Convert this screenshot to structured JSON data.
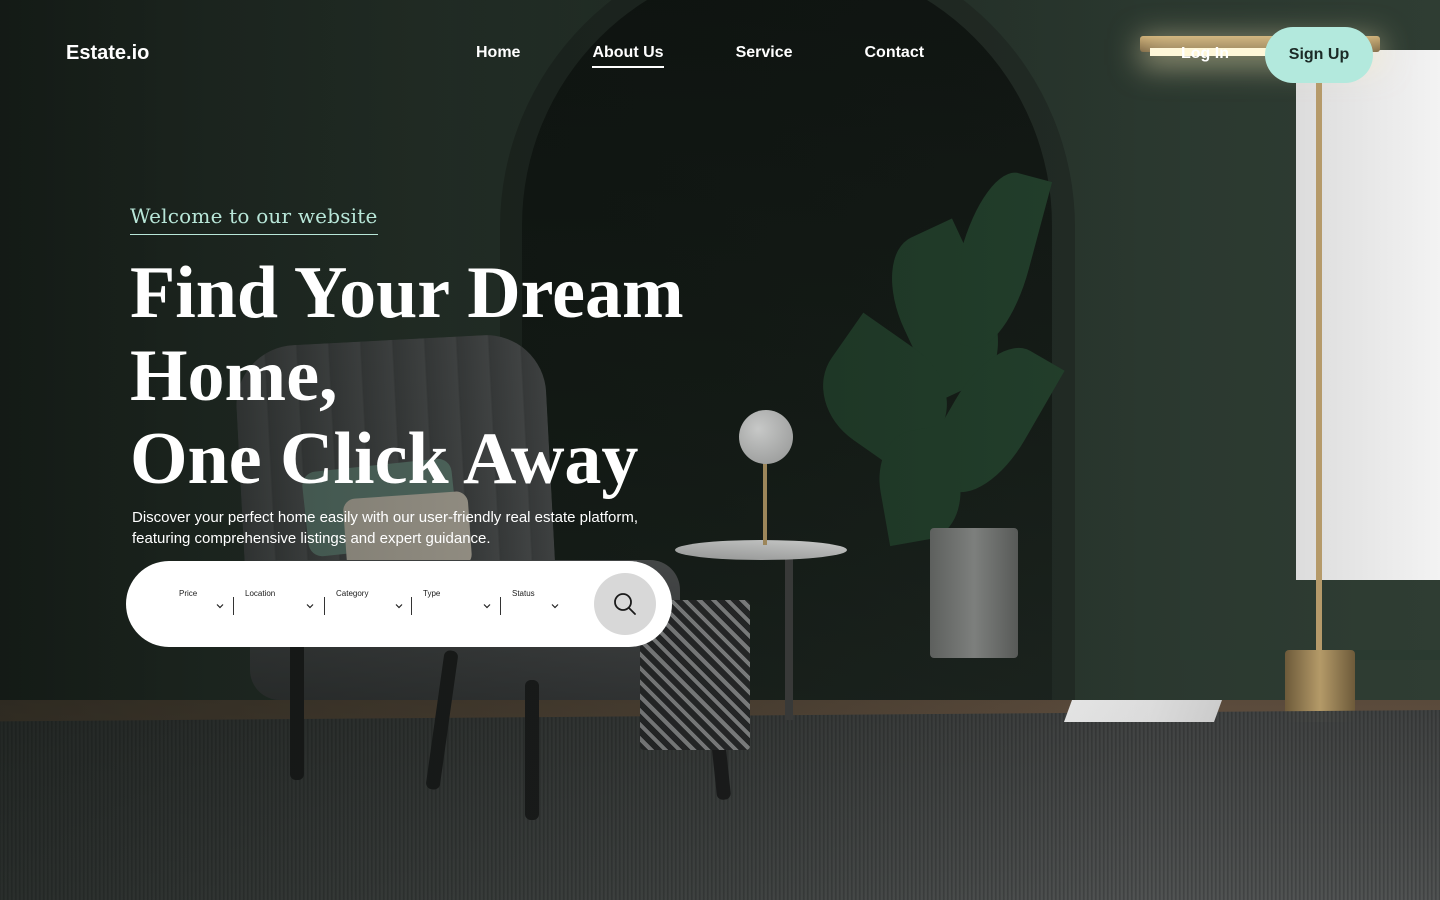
{
  "brand": {
    "name": "Estate.io"
  },
  "nav": {
    "items": [
      {
        "label": "Home",
        "active": false
      },
      {
        "label": "About Us",
        "active": true
      },
      {
        "label": "Service",
        "active": false
      },
      {
        "label": "Contact",
        "active": false
      }
    ]
  },
  "auth": {
    "login_label": "Log In",
    "signup_label": "Sign Up"
  },
  "hero": {
    "welcome": "Welcome to our website",
    "headline": [
      "Find Your Dream",
      "Home,",
      "One Click Away"
    ],
    "subtitle": "Discover your perfect home easily with our user-friendly real estate platform, featuring comprehensive listings and expert guidance."
  },
  "search": {
    "filters": [
      {
        "label": "Price"
      },
      {
        "label": "Location"
      },
      {
        "label": "Category"
      },
      {
        "label": "Type"
      },
      {
        "label": "Status"
      }
    ],
    "button_icon": "search-icon"
  },
  "colors": {
    "accent": "#b3e9dd",
    "welcome_text": "#b8e6d8",
    "wall": "#2d3a31"
  }
}
